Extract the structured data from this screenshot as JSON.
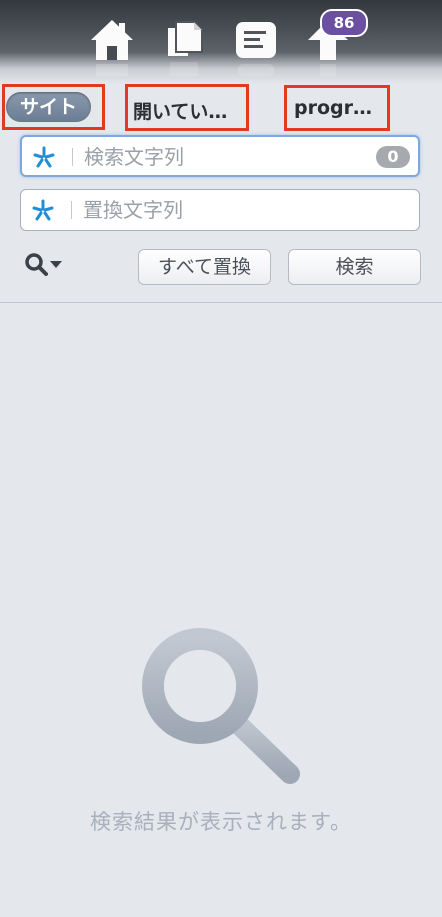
{
  "toolbar": {
    "buttons": [
      {
        "icon": "home-icon"
      },
      {
        "icon": "documents-icon"
      },
      {
        "icon": "outline-icon"
      },
      {
        "icon": "upload-arrow-icon"
      }
    ],
    "badge_count": "86"
  },
  "scope_tabs": [
    {
      "label": "サイト",
      "active": true
    },
    {
      "label": "開いてい…",
      "active": false
    },
    {
      "label": "progr…",
      "active": false
    }
  ],
  "search": {
    "placeholder": "検索文字列",
    "value": "",
    "match_count": "0",
    "regex_icon": "asterisk-icon"
  },
  "replace": {
    "placeholder": "置換文字列",
    "value": "",
    "regex_icon": "asterisk-icon"
  },
  "options": {
    "icon": "search-options-icon"
  },
  "buttons": {
    "replace_all": "すべて置換",
    "search": "検索"
  },
  "results": {
    "empty_icon": "magnifier-icon",
    "empty_message": "検索結果が表示されます。"
  },
  "colors": {
    "highlight": "#e23a1e",
    "badge": "#6b4fa0",
    "active_tab": "#7a8aa0",
    "regex_star": "#1f8fd8"
  }
}
